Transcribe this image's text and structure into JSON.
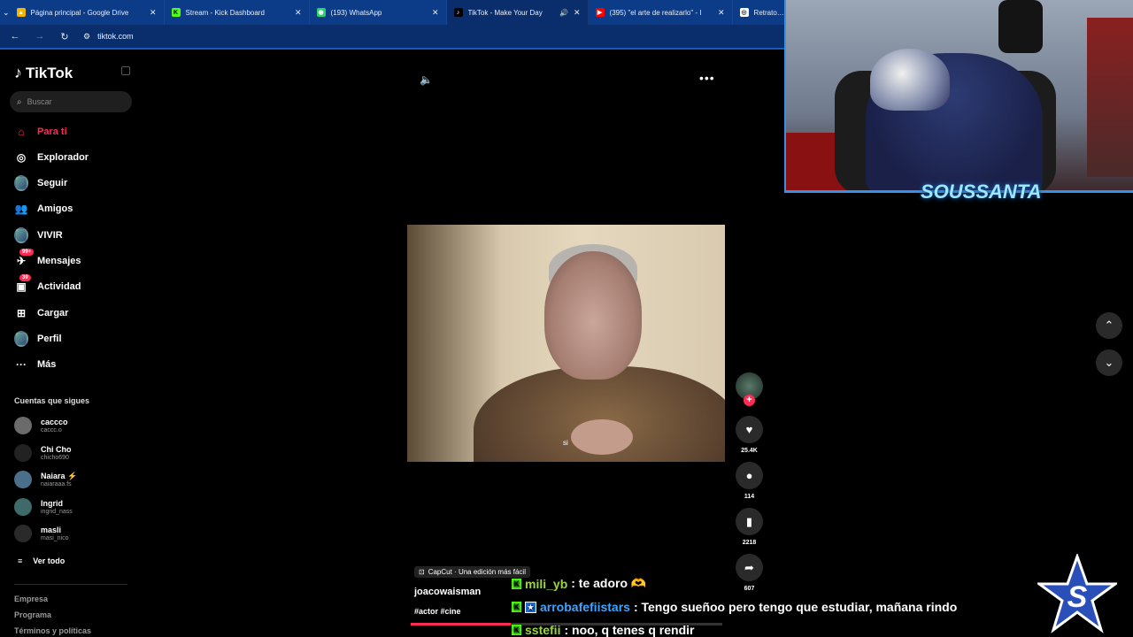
{
  "browser": {
    "tabs": [
      {
        "title": "Página principal - Google Drive",
        "color": "#f4b400",
        "glyph": "▲"
      },
      {
        "title": "Stream - Kick Dashboard",
        "color": "#53fc18",
        "glyph": "K"
      },
      {
        "title": "(193) WhatsApp",
        "color": "#25d366",
        "glyph": "◉"
      },
      {
        "title": "TikTok - Make Your Day",
        "color": "#000000",
        "glyph": "♪",
        "active": true
      },
      {
        "title": "(395) \"el arte de realizarlo\" - I",
        "color": "#ff0000",
        "glyph": "▶"
      },
      {
        "title": "Retrato con",
        "color": "#ffffff",
        "glyph": "◎"
      }
    ],
    "url": "tiktok.com"
  },
  "sidebar": {
    "brand": "TikTok",
    "search_placeholder": "Buscar",
    "nav": [
      {
        "label": "Para ti",
        "icon": "home-icon",
        "glyph": "⌂",
        "active": true
      },
      {
        "label": "Explorador",
        "icon": "compass-icon",
        "glyph": "◎"
      },
      {
        "label": "Seguir",
        "icon": "following-avatar-icon",
        "glyph": ""
      },
      {
        "label": "Amigos",
        "icon": "friends-icon",
        "glyph": "👥"
      },
      {
        "label": "VIVIR",
        "icon": "live-avatar-icon",
        "glyph": ""
      },
      {
        "label": "Mensajes",
        "icon": "messages-icon",
        "glyph": "✈",
        "badge": "99+"
      },
      {
        "label": "Actividad",
        "icon": "activity-icon",
        "glyph": "▣",
        "badge": "39"
      },
      {
        "label": "Cargar",
        "icon": "upload-icon",
        "glyph": "⊞"
      },
      {
        "label": "Perfil",
        "icon": "profile-avatar-icon",
        "glyph": ""
      },
      {
        "label": "Más",
        "icon": "more-dots-icon",
        "glyph": "···"
      }
    ],
    "following_heading": "Cuentas que sigues",
    "following": [
      {
        "name": "caccco",
        "handle": "caccc.o"
      },
      {
        "name": "Chi Cho",
        "handle": "chicho690"
      },
      {
        "name": "Naiara ⚡",
        "handle": "naiaraaa.fs"
      },
      {
        "name": "Ingrid",
        "handle": "ingrid_nass"
      },
      {
        "name": "masli",
        "handle": "masi_nico"
      }
    ],
    "see_all": "Ver todo",
    "footer": [
      "Empresa",
      "Programa",
      "Términos y políticas"
    ]
  },
  "video": {
    "subtitle": "si",
    "actions": [
      {
        "name": "like",
        "glyph": "♥",
        "count": "25.4K"
      },
      {
        "name": "comment",
        "glyph": "●",
        "count": "114"
      },
      {
        "name": "bookmark",
        "glyph": "▮",
        "count": "2218"
      },
      {
        "name": "share",
        "glyph": "➦",
        "count": "607"
      }
    ],
    "capcut": "CapCut · Una edición más fácil",
    "username": "joacowaisman",
    "hashtags": "#actor #cine",
    "progress": 0.32
  },
  "stream": {
    "streamer_name": "SOUSSANTA",
    "chat": [
      {
        "user": "mili_yb",
        "message": ": te adoro 🫶",
        "user_color": "green"
      },
      {
        "user": "arrobafefiistars",
        "message": ": Tengo sueñoo pero tengo que estudiar, mañana rindo",
        "user_color": "blue",
        "extra_badge": true
      },
      {
        "user": "sstefii",
        "message": ": noo, q tenes q rendir",
        "user_color": "green"
      }
    ]
  }
}
